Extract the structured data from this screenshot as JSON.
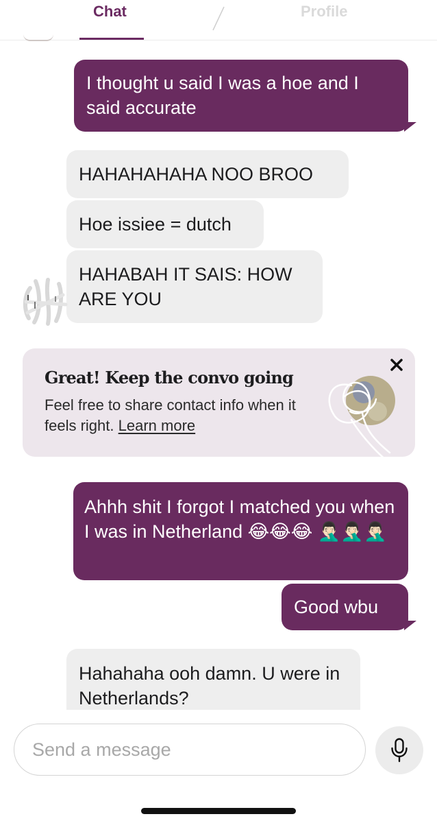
{
  "tabs": {
    "chat": "Chat",
    "profile": "Profile"
  },
  "messages": [
    {
      "from": "me",
      "text": "I thought u said I was a hoe and I said accurate"
    },
    {
      "from": "them",
      "text": "HAHAHAHAHA NOO BROO"
    },
    {
      "from": "them",
      "text": "Hoe issiee = dutch"
    },
    {
      "from": "them",
      "text": "HAHABAH IT SAIS: HOW ARE YOU"
    },
    {
      "from": "me",
      "text": "Ahhh shit I forgot I matched you when I was in Netherland 😂😂😂 🤦🏻‍♂️🤦🏻‍♂️🤦🏻‍♂️"
    },
    {
      "from": "me",
      "text": "Good wbu"
    },
    {
      "from": "them",
      "text": "Hahahaha ooh damn. U were in Netherlands?"
    }
  ],
  "tip": {
    "title": "Great! Keep the convo going",
    "body": "Feel free to share contact info when it feels right.",
    "link": "Learn more"
  },
  "composer": {
    "placeholder": "Send a message"
  },
  "icons": {
    "close": "close-icon",
    "mic": "microphone-icon"
  },
  "colors": {
    "accent": "#692b5f",
    "received_bubble": "#eeeeee",
    "tip_card": "#ede6ec"
  }
}
